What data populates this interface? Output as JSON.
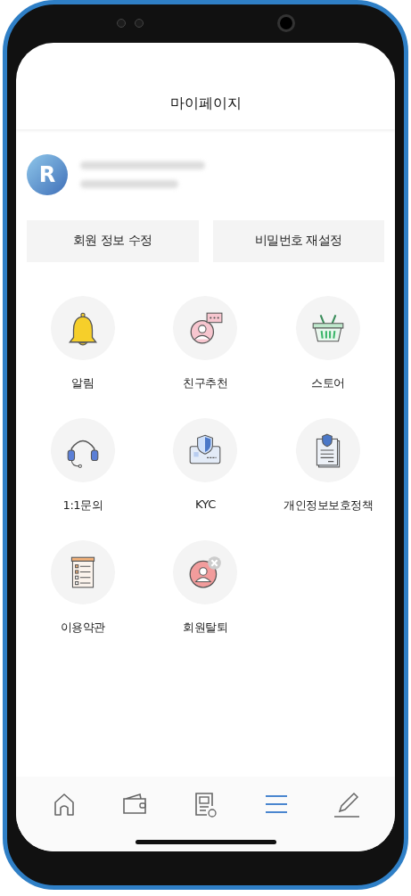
{
  "header": {
    "title": "마이페이지"
  },
  "profile": {
    "avatar_letter": "R"
  },
  "account_buttons": [
    "회원 정보 수정",
    "비밀번호 재설정"
  ],
  "menu": [
    {
      "label": "알림",
      "kind": "bell"
    },
    {
      "label": "친구추천",
      "kind": "referral"
    },
    {
      "label": "스토어",
      "kind": "basket"
    },
    {
      "label": "1:1문의",
      "kind": "headset"
    },
    {
      "label": "KYC",
      "kind": "idcard"
    },
    {
      "label": "개인정보보호정책",
      "kind": "policy"
    },
    {
      "label": "이용약관",
      "kind": "terms"
    },
    {
      "label": "회원탈퇴",
      "kind": "withdraw"
    }
  ],
  "bottom_nav": [
    {
      "kind": "home",
      "selected": false
    },
    {
      "kind": "wallet",
      "selected": false
    },
    {
      "kind": "document",
      "selected": false
    },
    {
      "kind": "menu",
      "selected": true
    },
    {
      "kind": "pencil",
      "selected": false
    }
  ]
}
